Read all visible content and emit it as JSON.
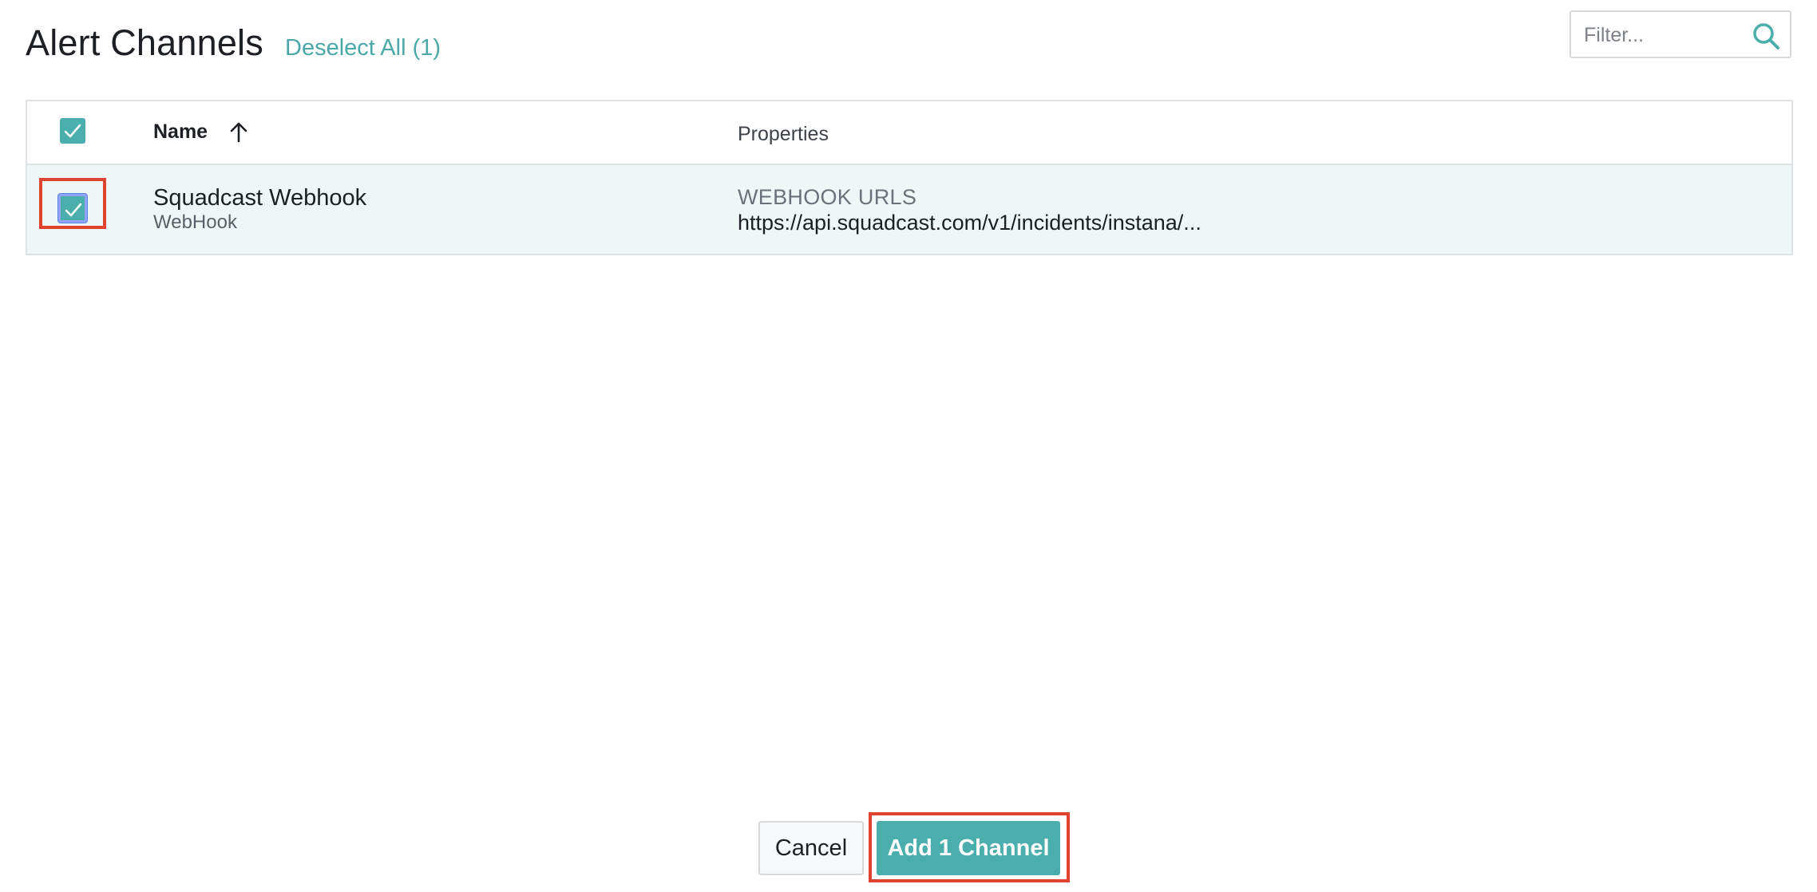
{
  "header": {
    "title": "Alert Channels",
    "deselect_label": "Deselect All (1)"
  },
  "filter": {
    "placeholder": "Filter...",
    "value": ""
  },
  "table": {
    "columns": {
      "name": "Name",
      "properties": "Properties"
    },
    "sort": {
      "column": "name",
      "direction": "ascending"
    },
    "header_checkbox_checked": true,
    "rows": [
      {
        "checked": true,
        "name": "Squadcast Webhook",
        "type": "WebHook",
        "property_label": "WEBHOOK URLS",
        "property_value": "https://api.squadcast.com/v1/incidents/instana/..."
      }
    ]
  },
  "footer": {
    "cancel_label": "Cancel",
    "add_label": "Add 1 Channel"
  },
  "colors": {
    "accent": "#4aaeac",
    "link": "#4aa9a8",
    "highlight": "#e0432f",
    "selected_row": "#eef6f6"
  },
  "icons": {
    "search": "search-icon",
    "sort": "arrow-up-icon",
    "check": "check-icon"
  }
}
